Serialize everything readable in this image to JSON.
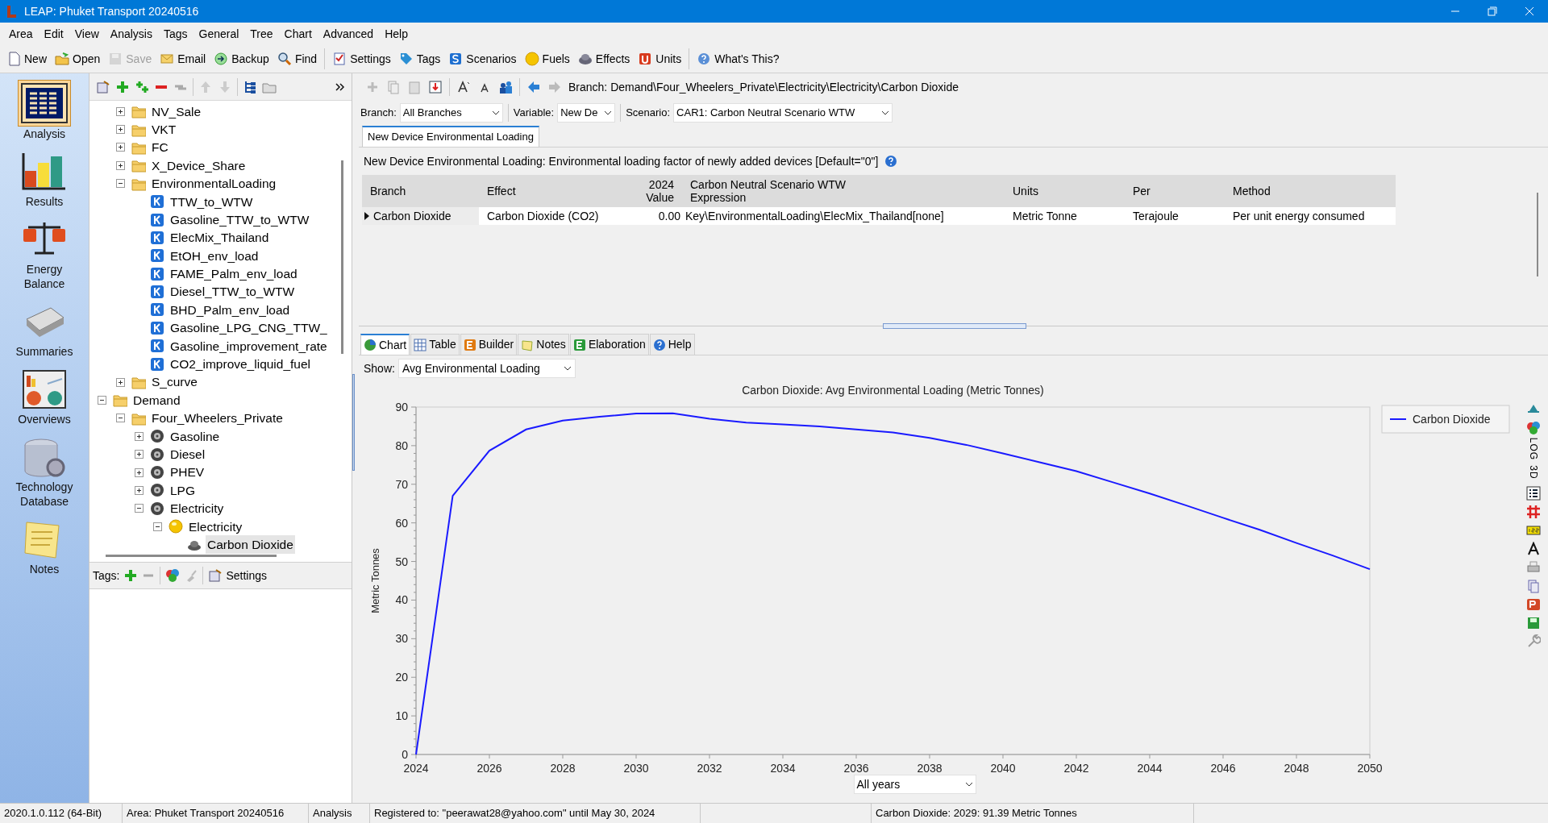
{
  "window": {
    "title": "LEAP: Phuket Transport 20240516"
  },
  "menu": [
    "Area",
    "Edit",
    "View",
    "Analysis",
    "Tags",
    "General",
    "Tree",
    "Chart",
    "Advanced",
    "Help"
  ],
  "toolbar": [
    {
      "kind": "new",
      "label": "New",
      "disabled": false
    },
    {
      "kind": "open",
      "label": "Open",
      "disabled": false
    },
    {
      "kind": "save",
      "label": "Save",
      "disabled": true
    },
    {
      "kind": "email",
      "label": "Email",
      "disabled": false
    },
    {
      "kind": "backup",
      "label": "Backup",
      "disabled": false
    },
    {
      "kind": "find",
      "label": "Find",
      "disabled": false
    },
    {
      "kind": "settings",
      "label": "Settings",
      "disabled": false
    },
    {
      "kind": "tags",
      "label": "Tags",
      "disabled": false
    },
    {
      "kind": "scenarios",
      "label": "Scenarios",
      "disabled": false
    },
    {
      "kind": "fuels",
      "label": "Fuels",
      "disabled": false
    },
    {
      "kind": "effects",
      "label": "Effects",
      "disabled": false
    },
    {
      "kind": "units",
      "label": "Units",
      "disabled": false
    },
    {
      "kind": "whatsthis",
      "label": "What's This?",
      "disabled": false
    }
  ],
  "views": [
    {
      "kind": "analysis",
      "label": "Analysis",
      "selected": true
    },
    {
      "kind": "results",
      "label": "Results",
      "selected": false
    },
    {
      "kind": "balance",
      "label": "Energy Balance",
      "selected": false
    },
    {
      "kind": "summaries",
      "label": "Summaries",
      "selected": false
    },
    {
      "kind": "overviews",
      "label": "Overviews",
      "selected": false
    },
    {
      "kind": "database",
      "label": "Technology Database",
      "selected": false
    },
    {
      "kind": "notes",
      "label": "Notes",
      "selected": false
    }
  ],
  "tree": [
    {
      "kind": "offscreen",
      "children": [
        {
          "kind": "folder",
          "label": "NV_Sale",
          "expanded": false,
          "selected": false
        },
        {
          "kind": "folder",
          "label": "VKT",
          "expanded": false,
          "selected": false
        },
        {
          "kind": "folder",
          "label": "FC",
          "expanded": false,
          "selected": false
        },
        {
          "kind": "folder",
          "label": "X_Device_Share",
          "expanded": false,
          "selected": false
        },
        {
          "kind": "folder",
          "label": "EnvironmentalLoading",
          "expanded": true,
          "selected": false,
          "children": [
            {
              "kind": "key",
              "label": "TTW_to_WTW",
              "selected": false
            },
            {
              "kind": "key",
              "label": "Gasoline_TTW_to_WTW",
              "selected": false
            },
            {
              "kind": "key",
              "label": "ElecMix_Thailand",
              "selected": false
            },
            {
              "kind": "key",
              "label": "EtOH_env_load",
              "selected": false
            },
            {
              "kind": "key",
              "label": "FAME_Palm_env_load",
              "selected": false
            },
            {
              "kind": "key",
              "label": "Diesel_TTW_to_WTW",
              "selected": false
            },
            {
              "kind": "key",
              "label": "BHD_Palm_env_load",
              "selected": false
            },
            {
              "kind": "key",
              "label": "Gasoline_LPG_CNG_TTW_",
              "selected": false
            },
            {
              "kind": "key",
              "label": "Gasoline_improvement_rate",
              "selected": false
            },
            {
              "kind": "key",
              "label": "CO2_improve_liquid_fuel",
              "selected": false
            }
          ]
        },
        {
          "kind": "folder",
          "label": "S_curve",
          "expanded": false,
          "selected": false
        }
      ]
    },
    {
      "kind": "folder",
      "label": "Demand",
      "expanded": true,
      "selected": false,
      "children": [
        {
          "kind": "folder",
          "label": "Four_Wheelers_Private",
          "expanded": true,
          "selected": false,
          "children": [
            {
              "kind": "device",
              "label": "Gasoline",
              "expanded": false,
              "selected": false
            },
            {
              "kind": "device",
              "label": "Diesel",
              "expanded": false,
              "selected": false
            },
            {
              "kind": "device",
              "label": "PHEV",
              "expanded": false,
              "selected": false
            },
            {
              "kind": "device",
              "label": "LPG",
              "expanded": false,
              "selected": false
            },
            {
              "kind": "device",
              "label": "Electricity",
              "expanded": true,
              "selected": false,
              "children": [
                {
                  "kind": "fuel",
                  "label": "Electricity",
                  "expanded": true,
                  "selected": false,
                  "children": [
                    {
                      "kind": "effect",
                      "label": "Carbon Dioxide",
                      "selected": true
                    }
                  ]
                }
              ]
            }
          ]
        }
      ]
    }
  ],
  "tags_bar": {
    "label": "Tags:",
    "settings": "Settings"
  },
  "breadcrumb": "Branch: Demand\\Four_Wheelers_Private\\Electricity\\Electricity\\Carbon Dioxide",
  "selectors": [
    {
      "label": "Branch:",
      "value": "All Branches"
    },
    {
      "label": "Variable:",
      "value": "New De"
    },
    {
      "label": "Scenario:",
      "value": "CAR1: Carbon Neutral Scenario WTW"
    }
  ],
  "variable_tabs": [
    {
      "label": "New Device Environmental Loading",
      "selected": true
    }
  ],
  "description": "New Device Environmental Loading: Environmental loading factor of newly added devices [Default=\"0\"]",
  "table": {
    "columns": [
      "Branch",
      "Effect",
      "2024 Value",
      "Carbon Neutral Scenario WTW Expression",
      "Units",
      "Per",
      "Method"
    ],
    "rows": [
      {
        "current": true,
        "cells": [
          "Carbon Dioxide",
          "Carbon Dioxide (CO2)",
          "0.00",
          "Key\\EnvironmentalLoading\\ElecMix_Thailand[none]",
          "Metric Tonne",
          "Terajoule",
          "Per unit energy consumed"
        ]
      }
    ]
  },
  "view_tabs": [
    {
      "kind": "chart",
      "label": "Chart",
      "selected": true
    },
    {
      "kind": "table",
      "label": "Table",
      "selected": false
    },
    {
      "kind": "builder",
      "label": "Builder",
      "selected": false
    },
    {
      "kind": "notes",
      "label": "Notes",
      "selected": false
    },
    {
      "kind": "elaboration",
      "label": "Elaboration",
      "selected": false
    },
    {
      "kind": "help",
      "label": "Help",
      "selected": false
    }
  ],
  "show": {
    "label": "Show:",
    "value": "Avg Environmental Loading"
  },
  "chart": {
    "chart_data": {
      "type": "line",
      "title": "Carbon Dioxide: Avg Environmental Loading (Metric Tonnes)",
      "ylabel": "Metric Tonnes",
      "x": [
        2024,
        2025,
        2026,
        2027,
        2028,
        2029,
        2030,
        2031,
        2032,
        2033,
        2034,
        2035,
        2036,
        2037,
        2038,
        2039,
        2040,
        2041,
        2042,
        2043,
        2044,
        2045,
        2046,
        2047,
        2048,
        2049,
        2050
      ],
      "series": [
        {
          "name": "Carbon Dioxide",
          "color": "#1a1aff",
          "values": [
            0,
            67,
            78.7,
            84.2,
            86.5,
            87.5,
            88.3,
            88.4,
            87,
            86,
            85.5,
            85,
            84.2,
            83.4,
            82,
            80.2,
            78,
            75.7,
            73.4,
            70.5,
            67.6,
            64.5,
            61.3,
            58.2,
            54.8,
            51.5,
            48
          ]
        }
      ],
      "xlim": [
        2024,
        2050
      ],
      "ylim": [
        0,
        90
      ],
      "xticks": [
        2024,
        2026,
        2028,
        2030,
        2032,
        2034,
        2036,
        2038,
        2040,
        2042,
        2044,
        2046,
        2048,
        2050
      ],
      "yticks": [
        0,
        10,
        20,
        30,
        40,
        50,
        60,
        70,
        80,
        90
      ]
    }
  },
  "chart_tools": [
    {
      "kind": "axis"
    },
    {
      "kind": "palette"
    },
    {
      "kind": "text",
      "label": "LOG"
    },
    {
      "kind": "text",
      "label": "3D"
    },
    {
      "kind": "legend"
    },
    {
      "kind": "grid"
    },
    {
      "kind": "values"
    },
    {
      "kind": "font"
    },
    {
      "kind": "print"
    },
    {
      "kind": "copy"
    },
    {
      "kind": "slides"
    },
    {
      "kind": "save"
    },
    {
      "kind": "wrench"
    }
  ],
  "period": {
    "value": "All years"
  },
  "status_bar": [
    "2020.1.0.112 (64-Bit)",
    "Area: Phuket Transport 20240516",
    "Analysis",
    "Registered to: \"peerawat28@yahoo.com\" until May 30, 2024",
    "Carbon Dioxide: 2029: 91.39 Metric Tonnes"
  ]
}
